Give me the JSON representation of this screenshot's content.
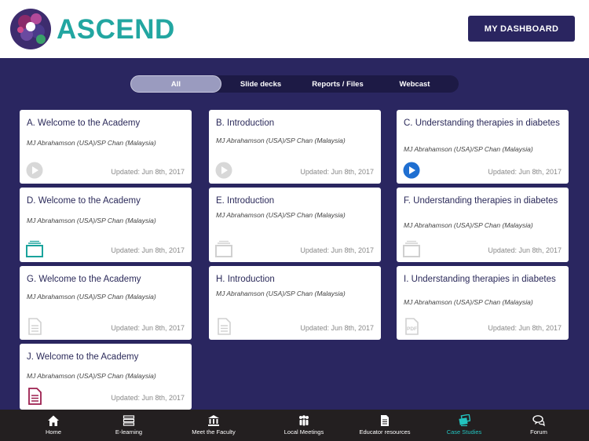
{
  "header": {
    "logo_text": "ASCEND",
    "dashboard_label": "MY DASHBOARD"
  },
  "filters": [
    {
      "label": "All",
      "active": true
    },
    {
      "label": "Slide decks",
      "active": false
    },
    {
      "label": "Reports / Files",
      "active": false
    },
    {
      "label": "Webcast",
      "active": false
    }
  ],
  "cards": [
    {
      "title": "A. Welcome to the Academy",
      "author": "MJ Abrahamson (USA)/SP Chan (Malaysia)",
      "updated": "Updated: Jun 8th, 2017",
      "icon": "play-icon-inactive"
    },
    {
      "title": "B. Introduction",
      "author": "MJ Abrahamson (USA)/SP Chan (Malaysia)",
      "updated": "Updated: Jun 8th, 2017",
      "icon": "play-icon-inactive"
    },
    {
      "title": "C. Understanding therapies in diabetes",
      "author": "MJ Abrahamson (USA)/SP Chan (Malaysia)",
      "updated": "Updated: Jun 8th, 2017",
      "icon": "play-icon-active"
    },
    {
      "title": "D. Welcome to the Academy",
      "author": "MJ Abrahamson (USA)/SP Chan (Malaysia)",
      "updated": "Updated: Jun 8th, 2017",
      "icon": "slides-icon-active"
    },
    {
      "title": "E. Introduction",
      "author": "MJ Abrahamson (USA)/SP Chan (Malaysia)",
      "updated": "Updated: Jun 8th, 2017",
      "icon": "slides-icon-inactive"
    },
    {
      "title": "F. Understanding therapies in diabetes",
      "author": "MJ Abrahamson (USA)/SP Chan (Malaysia)",
      "updated": "Updated: Jun 8th, 2017",
      "icon": "slides-icon-inactive"
    },
    {
      "title": "G. Welcome to the Academy",
      "author": "MJ Abrahamson (USA)/SP Chan (Malaysia)",
      "updated": "Updated: Jun 8th, 2017",
      "icon": "document-icon-inactive"
    },
    {
      "title": "H. Introduction",
      "author": "MJ Abrahamson (USA)/SP Chan (Malaysia)",
      "updated": "Updated: Jun 8th, 2017",
      "icon": "document-icon-inactive"
    },
    {
      "title": "I. Understanding therapies in diabetes",
      "author": "MJ Abrahamson (USA)/SP Chan (Malaysia)",
      "updated": "Updated: Jun 8th, 2017",
      "icon": "pdf-icon-inactive"
    },
    {
      "title": "J. Welcome to the Academy",
      "author": "MJ Abrahamson (USA)/SP Chan (Malaysia)",
      "updated": "Updated: Jun 8th, 2017",
      "icon": "document-icon-active"
    }
  ],
  "nav": [
    {
      "label": "Home",
      "icon": "home-icon",
      "active": false
    },
    {
      "label": "E-learning",
      "icon": "stack-icon",
      "active": false
    },
    {
      "label": "Meet the Faculty",
      "icon": "institution-icon",
      "active": false
    },
    {
      "label": "Local Meetings",
      "icon": "people-icon",
      "active": false
    },
    {
      "label": "Educator resources",
      "icon": "document-icon",
      "active": false
    },
    {
      "label": "Case Studies",
      "icon": "cards-icon",
      "active": true
    },
    {
      "label": "Forum",
      "icon": "chat-icon",
      "active": false
    }
  ],
  "colors": {
    "brand_navy": "#2a2660",
    "brand_teal": "#22a6a1",
    "play_blue": "#1f6fd1",
    "doc_maroon": "#9c1f4e",
    "nav_bg": "#231f20"
  }
}
